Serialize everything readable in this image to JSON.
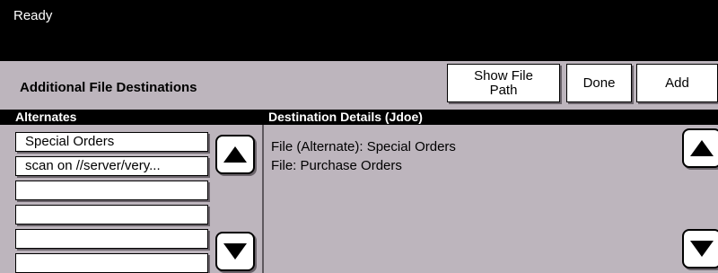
{
  "status": {
    "text": "Ready"
  },
  "toolbar": {
    "title": "Additional File Destinations",
    "show_file_path_label_line1": "Show File",
    "show_file_path_label_line2": "Path",
    "done_label": "Done",
    "add_label": "Add"
  },
  "alternates": {
    "header": "Alternates",
    "items": [
      {
        "label": "Special Orders"
      },
      {
        "label": "scan on //server/very..."
      },
      {
        "label": ""
      },
      {
        "label": ""
      },
      {
        "label": ""
      },
      {
        "label": ""
      }
    ],
    "scroll_up_icon": "up-arrow-icon",
    "scroll_down_icon": "down-arrow-icon"
  },
  "details": {
    "header": "Destination Details (Jdoe)",
    "lines": [
      "File (Alternate): Special Orders",
      "File: Purchase Orders"
    ],
    "scroll_up_icon": "up-arrow-icon",
    "scroll_down_icon": "down-arrow-icon"
  }
}
